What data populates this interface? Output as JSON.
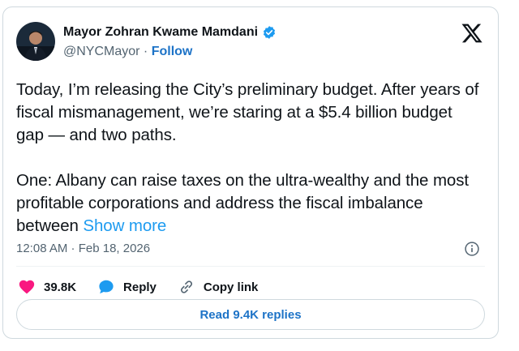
{
  "author": {
    "name": "Mayor Zohran Kwame Mamdani",
    "handle": "@NYCMayor",
    "separator": " · ",
    "follow_label": "Follow"
  },
  "icons": {
    "verified": "verified-badge-icon",
    "logo": "x-logo-icon",
    "info": "info-icon",
    "like": "heart-icon",
    "reply": "speech-bubble-icon",
    "copy": "link-icon"
  },
  "colors": {
    "accent_blue": "#1d9bf0",
    "follow_blue": "#1d73c7",
    "like_pink": "#f91880",
    "text": "#0f1419",
    "muted": "#536471",
    "border": "#cfd9de"
  },
  "tweet": {
    "text": "Today, I’m releasing the City’s preliminary budget. After years of fiscal mismanagement, we’re staring at a $5.4 billion budget gap — and two paths.\n\nOne: Albany can raise taxes on the ultra-wealthy and the most profitable corporations and address the fiscal imbalance between ",
    "show_more_label": "Show more",
    "timestamp": "12:08 AM · Feb 18, 2026"
  },
  "actions": {
    "like_count": "39.8K",
    "reply_label": "Reply",
    "copy_link_label": "Copy link"
  },
  "footer": {
    "read_replies_label": "Read 9.4K replies"
  }
}
